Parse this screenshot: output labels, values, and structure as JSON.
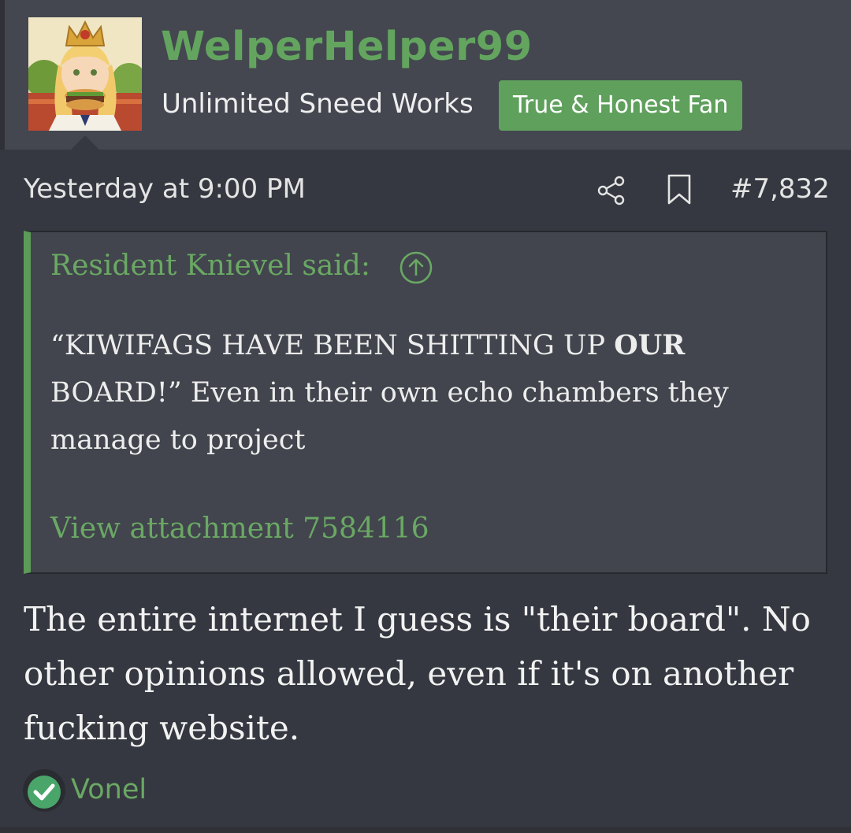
{
  "user": {
    "username": "WelperHelper99",
    "title": "Unlimited Sneed Works",
    "badge": "True & Honest Fan",
    "avatar_icon": "crowned-girl-eating-burger-avatar"
  },
  "post": {
    "date": "Yesterday at 9:00 PM",
    "number": "#7,832",
    "share_icon": "share-icon",
    "bookmark_icon": "bookmark-icon",
    "body": "The entire internet I guess is \"their board\". No other opinions allowed, even if it's on another fucking website."
  },
  "quote": {
    "author": "Resident Knievel said:",
    "text_before_bold": "“KIWIFAGS HAVE BEEN SHITTING UP ",
    "text_bold": "OUR",
    "text_after_bold": " BOARD!” Even in their own echo chambers they manage to project",
    "attachment": "View attachment 7584116"
  },
  "reaction": {
    "icon": "checkmark-icon",
    "user": "Vonel"
  },
  "colors": {
    "accent_green": "#63a55f",
    "badge_green": "#5fa05c",
    "background": "#353840",
    "header_background": "#444750"
  }
}
